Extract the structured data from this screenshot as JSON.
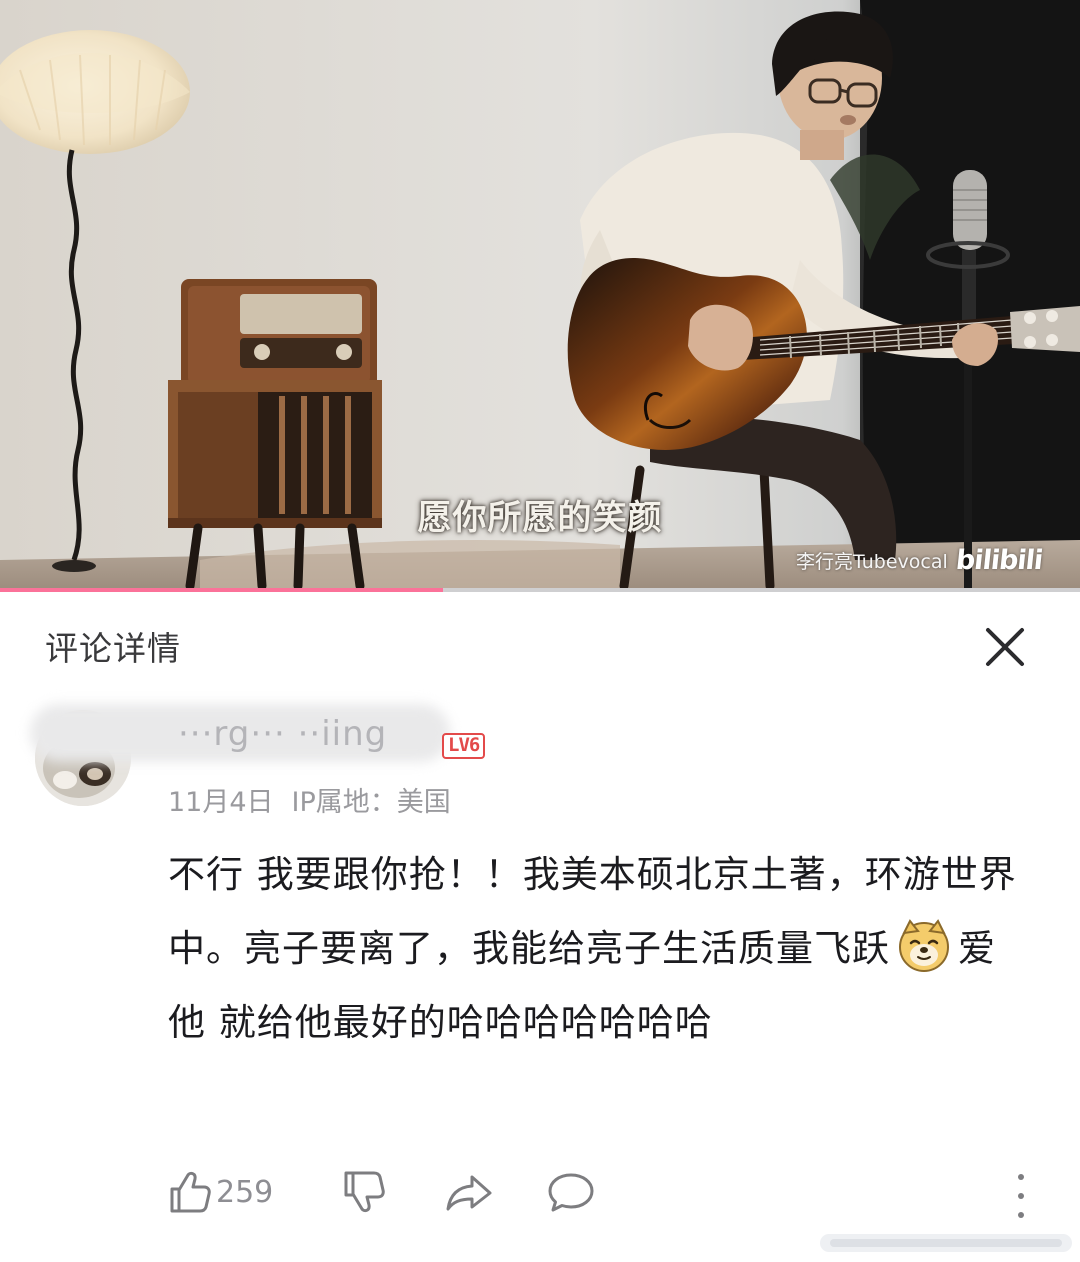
{
  "video": {
    "subtitle": "愿你所愿的笑颜",
    "author_watermark": "李行亮Tubevocal",
    "platform_logo": "bilibili",
    "progress_percent": 41,
    "progress_color": "#fb7299"
  },
  "panel": {
    "title": "评论详情",
    "close_icon": "close-icon"
  },
  "comment": {
    "username": "···rg··· ··iing",
    "level": "LV6",
    "date": "11月4日",
    "ip_location": "IP属地：美国",
    "text_before_emoji": "不行 我要跟你抢！！我美本硕北京土著，环游世界中。亮子要离了，我能给亮子生活质量飞跃",
    "emoji": "doge-emoji",
    "text_after_emoji": "爱他 就给他最好的哈哈哈哈哈哈哈"
  },
  "actions": {
    "like_icon": "thumbs-up-icon",
    "like_count": "259",
    "dislike_icon": "thumbs-down-icon",
    "share_icon": "share-icon",
    "reply_icon": "comment-bubble-icon",
    "more_icon": "more-vertical-icon"
  },
  "colors": {
    "level_badge": "#e34a4a",
    "accent_pink": "#fb7299"
  }
}
